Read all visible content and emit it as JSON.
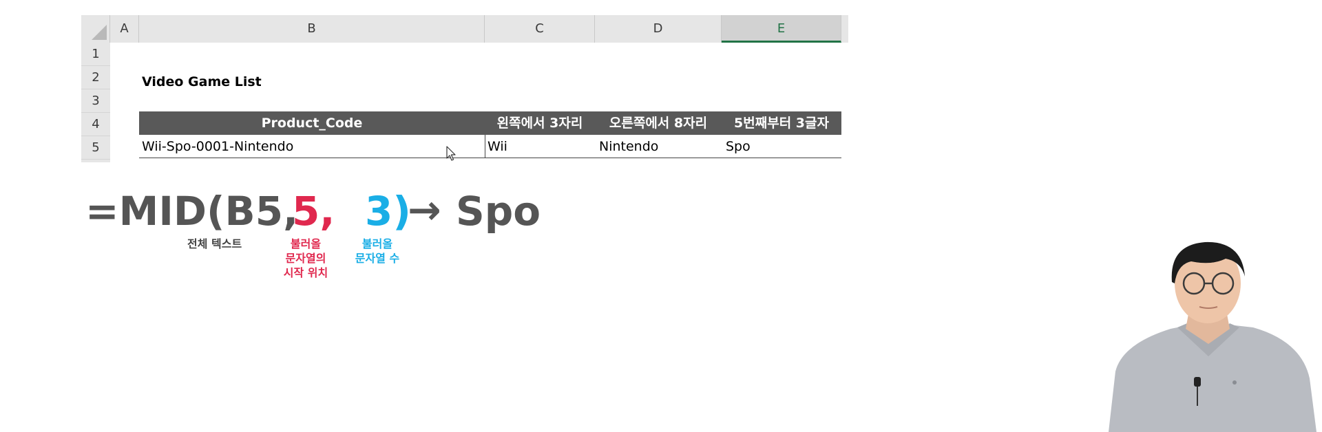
{
  "sheet": {
    "columns": [
      "A",
      "B",
      "C",
      "D",
      "E"
    ],
    "selected_column": "E",
    "rows": [
      "1",
      "2",
      "3",
      "4",
      "5"
    ],
    "title": "Video Game List",
    "headers": [
      "Product_Code",
      "왼쪽에서 3자리",
      "오른쪽에서 8자리",
      "5번째부터 3글자"
    ],
    "row5": [
      "Wii-Spo-0001-Nintendo",
      "Wii",
      "Nintendo",
      "Spo"
    ]
  },
  "formula": {
    "prefix": "=MID(B5,",
    "start": "5,",
    "count": "3)",
    "arrow": "→",
    "result": "Spo"
  },
  "notes": {
    "text_label": "전체 텍스트",
    "start_label_1": "불러올",
    "start_label_2": "문자열의",
    "start_label_3": "시작 위치",
    "count_label_1": "불러올",
    "count_label_2": "문자열 수"
  },
  "colors": {
    "header_bg": "#595959",
    "start_red": "#e0284e",
    "count_blue": "#1aaee6",
    "excel_green": "#217346"
  },
  "icons": [
    "mouse-pointer-icon"
  ]
}
